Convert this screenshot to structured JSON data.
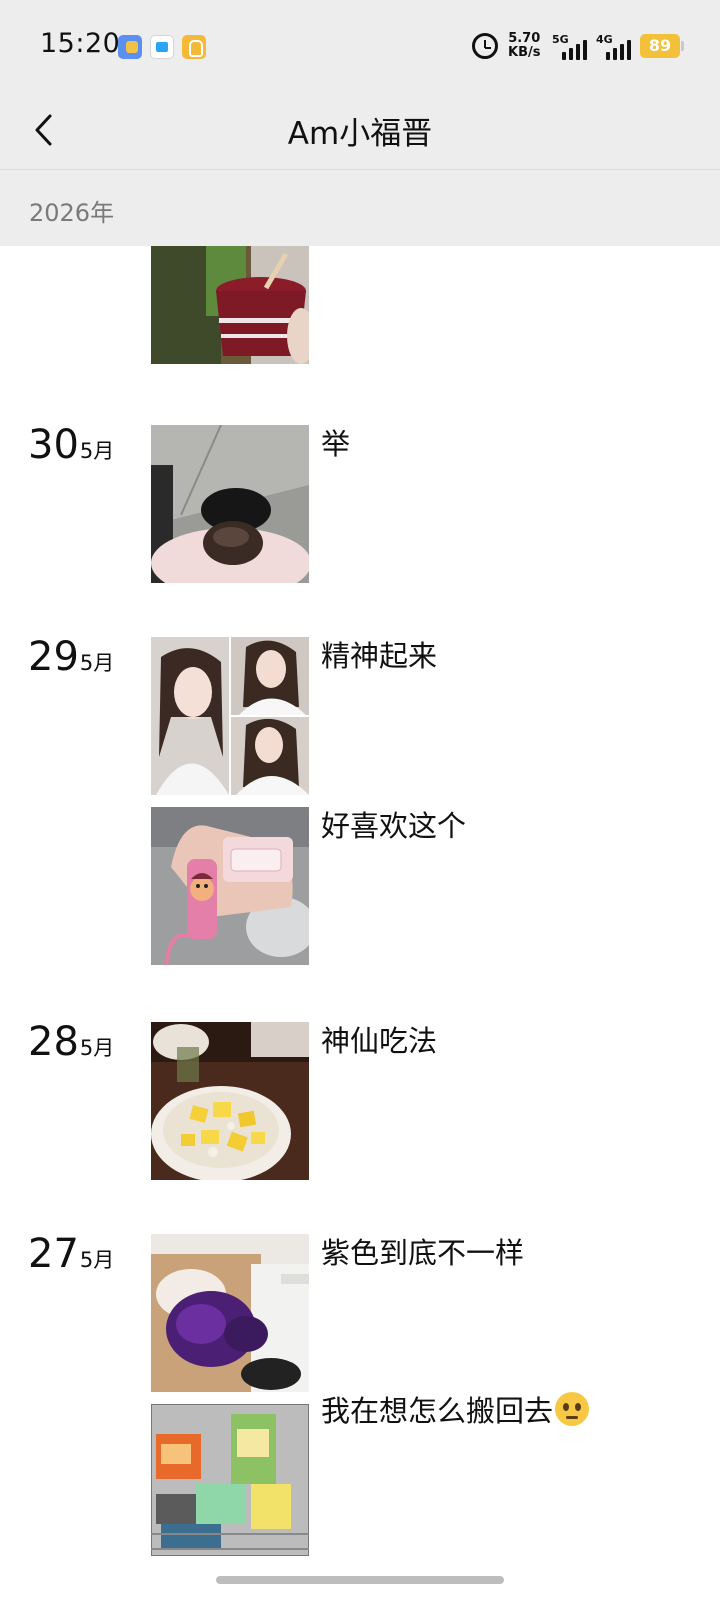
{
  "status_bar": {
    "time": "15:20",
    "speed_value": "5.70",
    "speed_unit": "KB/s",
    "net1": "5G",
    "net2": "4G",
    "battery": "89"
  },
  "header": {
    "title": "Am小福晋",
    "back_icon": "chevron-left-icon"
  },
  "year_label": "2026年",
  "posts": [
    {
      "day": "",
      "month": "",
      "text": "",
      "photo": "ice-cream-cup"
    },
    {
      "day": "30",
      "month": "5月",
      "text": "举",
      "photo": "selfie-from-above"
    },
    {
      "day": "29",
      "month": "5月",
      "text": "精神起来",
      "photo": "selfie-collage"
    },
    {
      "day": "",
      "month": "",
      "text": "好喜欢这个",
      "photo": "pink-keychain"
    },
    {
      "day": "28",
      "month": "5月",
      "text": "神仙吃法",
      "photo": "mango-bowl"
    },
    {
      "day": "27",
      "month": "5月",
      "text": "紫色到底不一样",
      "photo": "purple-clothes"
    },
    {
      "day": "",
      "month": "",
      "text": "我在想怎么搬回去",
      "emoji": "woozy-face",
      "photo": "shopping-cart"
    }
  ]
}
